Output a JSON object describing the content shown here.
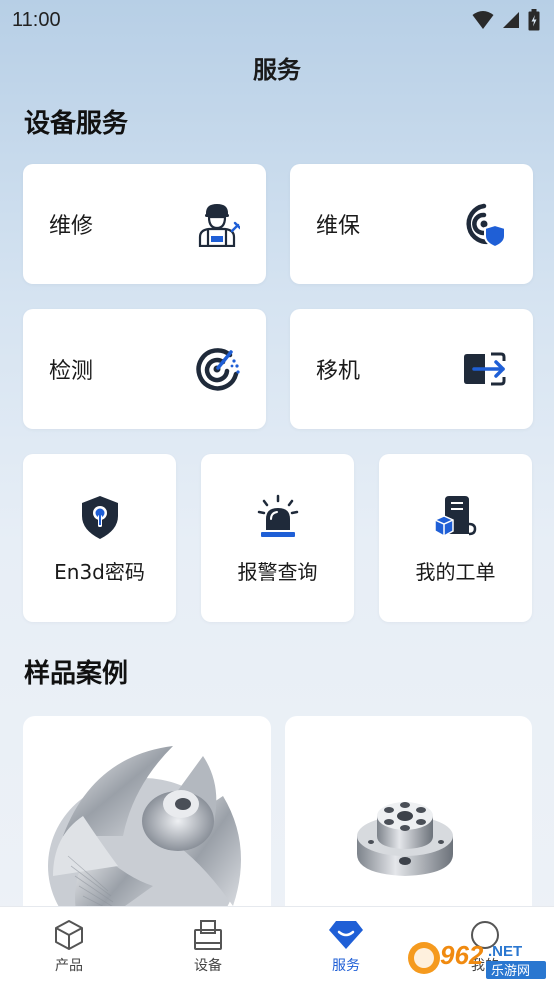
{
  "status_bar": {
    "time": "11:00"
  },
  "page": {
    "title": "服务"
  },
  "sections": {
    "device_services": "设备服务",
    "sample_cases": "样品案例"
  },
  "services": {
    "repair": {
      "label": "维修",
      "icon": "technician-icon"
    },
    "maintenance": {
      "label": "维保",
      "icon": "shield-radar-icon"
    },
    "inspection": {
      "label": "检测",
      "icon": "target-scan-icon"
    },
    "relocation": {
      "label": "移机",
      "icon": "move-out-icon"
    },
    "en3d_password": {
      "label": "En3d密码",
      "icon": "shield-keyhole-icon"
    },
    "alarm_query": {
      "label": "报警查询",
      "icon": "alarm-light-icon"
    },
    "my_work_orders": {
      "label": "我的工单",
      "icon": "work-order-box-icon"
    }
  },
  "cases": [
    {
      "subject": "impeller"
    },
    {
      "subject": "flange-part"
    }
  ],
  "bottom_nav": {
    "items": [
      {
        "label": "产品",
        "icon": "cube-icon"
      },
      {
        "label": "设备",
        "icon": "printer-icon"
      },
      {
        "label": "服务",
        "icon": "diamond-icon",
        "active": true
      },
      {
        "label": "我的",
        "icon": "user-icon"
      }
    ]
  },
  "watermark": {
    "number": "962",
    "suffix": ".NET",
    "site": "乐游网"
  },
  "colors": {
    "accent": "#1f5fd6",
    "icon_dark": "#1f2a3a"
  }
}
